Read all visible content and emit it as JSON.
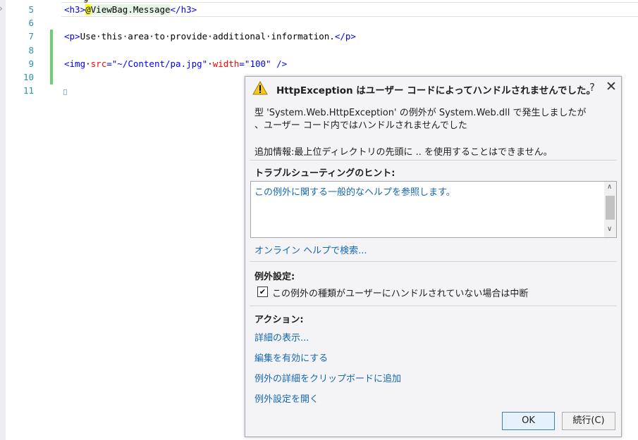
{
  "editor": {
    "top_fragment": "g",
    "lines": [
      {
        "num": "5",
        "segments": [
          {
            "t": "<h3>",
            "c": "tag"
          },
          {
            "t": "@",
            "c": "raz"
          },
          {
            "t": "ViewBag.Message",
            "c": "txt razexpr"
          },
          {
            "t": "</h3>",
            "c": "tag"
          }
        ]
      },
      {
        "num": "6",
        "segments": []
      },
      {
        "num": "7",
        "segments": [
          {
            "t": "<p>",
            "c": "tag"
          },
          {
            "t": "Use·this·area·to·provide·additional·information.",
            "c": "txt"
          },
          {
            "t": "</p>",
            "c": "tag"
          }
        ]
      },
      {
        "num": "8",
        "segments": []
      },
      {
        "num": "9",
        "segments": [
          {
            "t": "<img",
            "c": "tag"
          },
          {
            "t": "·",
            "c": "txt"
          },
          {
            "t": "src",
            "c": "attr"
          },
          {
            "t": "=",
            "c": "tag"
          },
          {
            "t": "\"~/Content/pa.jpg\"",
            "c": "str"
          },
          {
            "t": "·",
            "c": "txt"
          },
          {
            "t": "width",
            "c": "attr"
          },
          {
            "t": "=",
            "c": "tag"
          },
          {
            "t": "\"100\"",
            "c": "str"
          },
          {
            "t": " />",
            "c": "tag"
          }
        ]
      },
      {
        "num": "10",
        "segments": []
      },
      {
        "num": "11",
        "segments": []
      }
    ]
  },
  "dialog": {
    "title": "HttpException はユーザー コードによってハンドルされませんでした。",
    "help_label": "?",
    "close_label": "✕",
    "message_line1": "型 'System.Web.HttpException' の例外が System.Web.dll で発生しましたが",
    "message_line2": "、ユーザー コード内ではハンドルされませんでした",
    "additional_info": "追加情報:最上位ディレクトリの先頭に .. を使用することはできません。",
    "troubleshooting_title": "トラブルシューティングのヒント:",
    "tip_link": "この例外に関する一般的なヘルプを参照します。",
    "online_help": "オンライン ヘルプで検索...",
    "exception_settings_title": "例外設定:",
    "break_checkbox_label": "この例外の種類がユーザーにハンドルされていない場合は中断",
    "break_checked": true,
    "actions_title": "アクション:",
    "actions": [
      "詳細の表示...",
      "編集を有効にする",
      "例外の詳細をクリップボードに追加",
      "例外設定を開く"
    ],
    "ok_label": "OK",
    "continue_label": "続行(C)"
  }
}
